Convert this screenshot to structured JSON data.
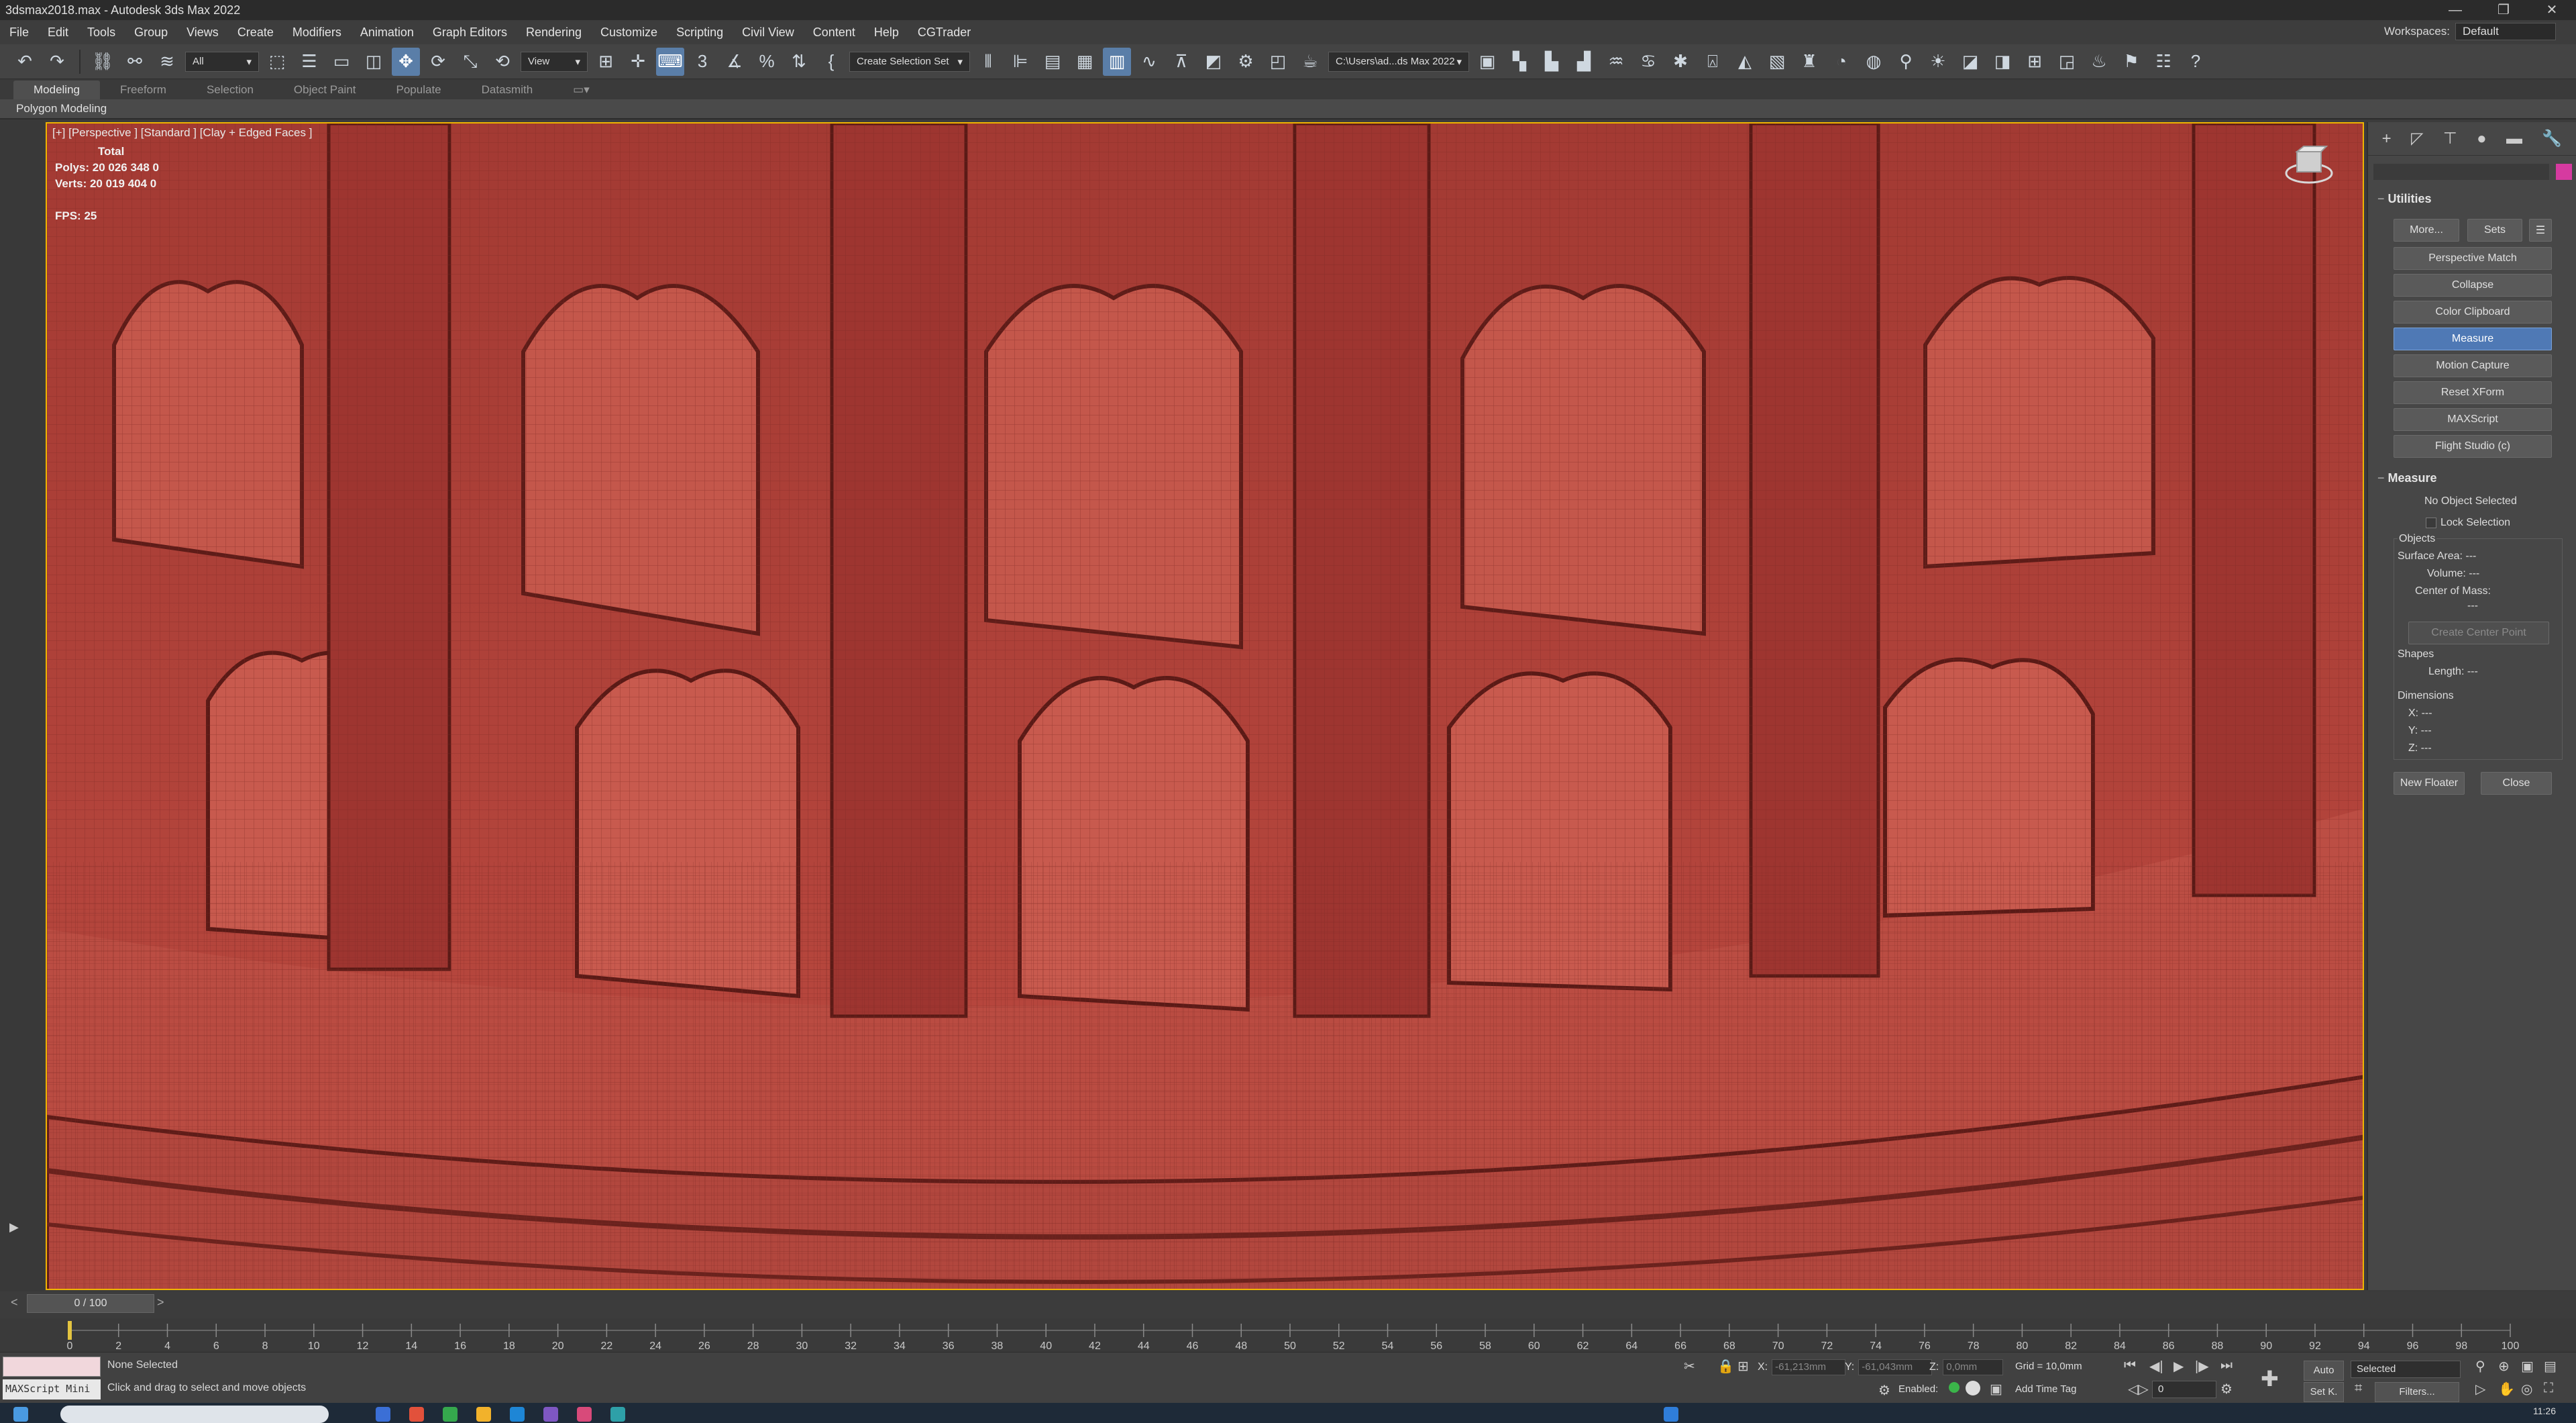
{
  "window": {
    "title": "3dsmax2018.max - Autodesk 3ds Max 2022",
    "minimize": "—",
    "maximize": "❐",
    "close": "✕"
  },
  "menubar": {
    "items": [
      "File",
      "Edit",
      "Tools",
      "Group",
      "Views",
      "Create",
      "Modifiers",
      "Animation",
      "Graph Editors",
      "Rendering",
      "Customize",
      "Scripting",
      "Civil View",
      "Content",
      "Help",
      "CGTrader"
    ],
    "workspaces_label": "Workspaces:",
    "workspaces_value": "Default"
  },
  "toolbar": {
    "selection_filter": "All",
    "ref_coord": "View",
    "named_selection": "Create Selection Set",
    "project_path": "C:\\Users\\ad...ds Max 2022"
  },
  "ribbon": {
    "tabs": [
      "Modeling",
      "Freeform",
      "Selection",
      "Object Paint",
      "Populate",
      "Datasmith"
    ],
    "active_tab": "Modeling",
    "sub_label": "Polygon Modeling"
  },
  "viewport": {
    "label": "[+] [Perspective ] [Standard ] [Clay + Edged Faces ]",
    "stats_total": "Total",
    "polys": "Polys:  20 026 348 0",
    "verts": "Verts:  20 019 404 0",
    "fps": "FPS:    25",
    "wire_color": "#b8453c"
  },
  "command_panel": {
    "utilities_header": "Utilities",
    "more_button": "More...",
    "sets_button": "Sets",
    "utility_buttons": [
      "Perspective Match",
      "Collapse",
      "Color Clipboard",
      "Measure",
      "Motion Capture",
      "Reset XForm",
      "MAXScript",
      "Flight Studio (c)"
    ],
    "active_utility": "Measure",
    "measure_header": "Measure",
    "no_object": "No Object Selected",
    "lock_selection": "Lock Selection",
    "objects_label": "Objects",
    "surface_area": "Surface Area:  ---",
    "volume": "Volume:  ---",
    "center_of_mass": "Center of Mass:",
    "com_value": "---",
    "create_center_point": "Create Center Point",
    "shapes_label": "Shapes",
    "length": "Length:  ---",
    "dimensions_label": "Dimensions",
    "dim_x": "X:  ---",
    "dim_y": "Y:  ---",
    "dim_z": "Z:  ---",
    "new_floater": "New Floater",
    "close": "Close",
    "accent_color": "#4f79b5"
  },
  "timeline": {
    "slider_text": "0 / 100",
    "ticks": [
      "0",
      "2",
      "4",
      "6",
      "8",
      "10",
      "12",
      "14",
      "16",
      "18",
      "20",
      "22",
      "24",
      "26",
      "28",
      "30",
      "32",
      "34",
      "36",
      "38",
      "40",
      "42",
      "44",
      "46",
      "48",
      "50",
      "52",
      "54",
      "56",
      "58",
      "60",
      "62",
      "64",
      "66",
      "68",
      "70",
      "72",
      "74",
      "76",
      "78",
      "80",
      "82",
      "84",
      "86",
      "88",
      "90",
      "92",
      "94",
      "96",
      "98",
      "100"
    ],
    "current_frame": 0
  },
  "status": {
    "selection": "None Selected",
    "prompt": "Click and drag to select and move objects",
    "maxscript": "MAXScript Mini",
    "x_label": "X:",
    "x_value": "-61,213mm",
    "y_label": "Y:",
    "y_value": "-61,043mm",
    "z_label": "Z:",
    "z_value": "0,0mm",
    "grid": "Grid = 10,0mm",
    "enabled": "Enabled:",
    "add_time_tag": "Add Time Tag",
    "auto": "Auto",
    "set_key": "Set K.",
    "key_filter": "Selected",
    "filters": "Filters...",
    "frame_field": "0",
    "clock": "11:26"
  }
}
